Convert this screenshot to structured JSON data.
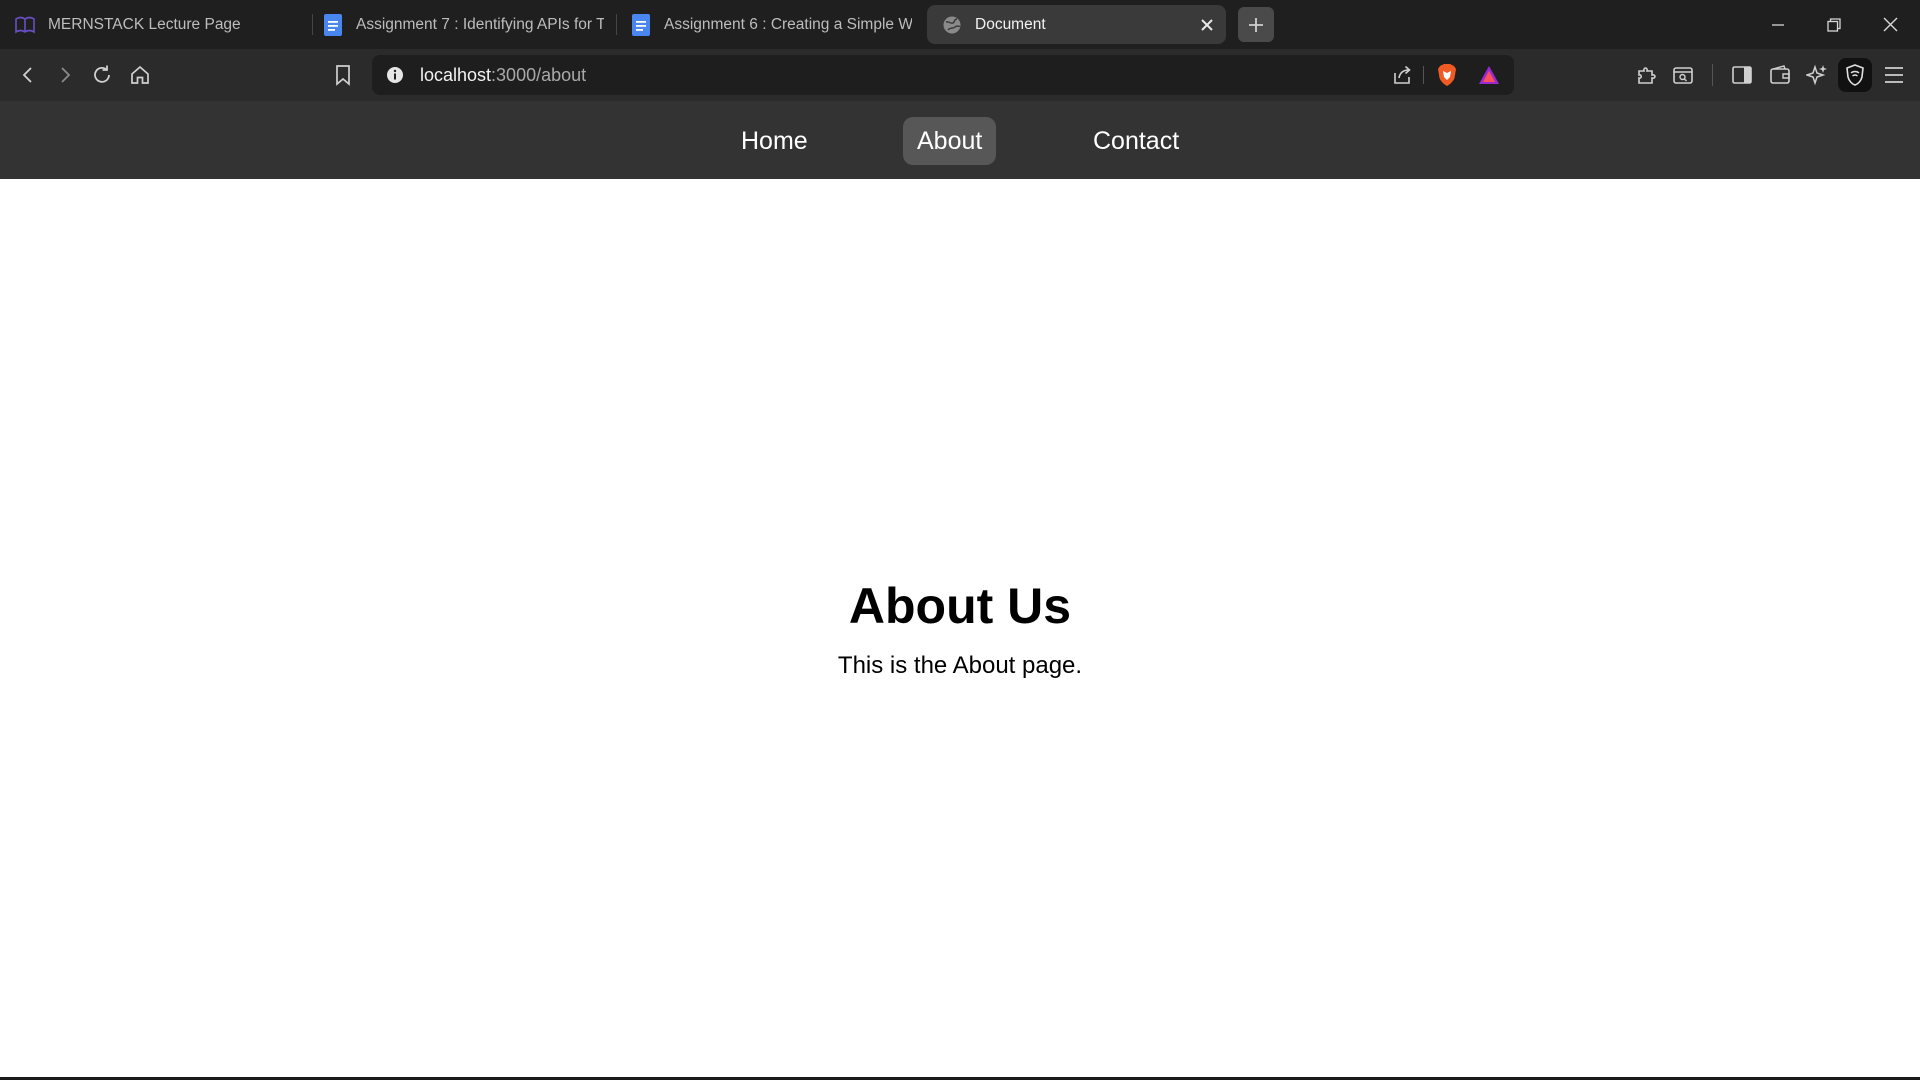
{
  "browser": {
    "tabs": [
      {
        "title": "MERNSTACK Lecture Page",
        "icon": "book-icon",
        "active": false
      },
      {
        "title": "Assignment 7 : Identifying APIs for To",
        "icon": "docs-icon",
        "active": false
      },
      {
        "title": "Assignment 6 : Creating a Simple We",
        "icon": "docs-icon",
        "active": false
      },
      {
        "title": "Document",
        "icon": "globe-icon",
        "active": true
      }
    ],
    "url_host": "localhost",
    "url_path": ":3000/about",
    "colors": {
      "chrome_dark": "#1f1f1f",
      "toolbar": "#2b2b2b",
      "brave": "#f05a24",
      "rewards": "#9b2bd1"
    }
  },
  "site": {
    "nav": {
      "home": "Home",
      "about": "About",
      "contact": "Contact",
      "active": "about"
    },
    "title": "About Us",
    "text": "This is the About page.",
    "colors": {
      "nav_bg": "#333333",
      "nav_active": "#575757"
    }
  }
}
